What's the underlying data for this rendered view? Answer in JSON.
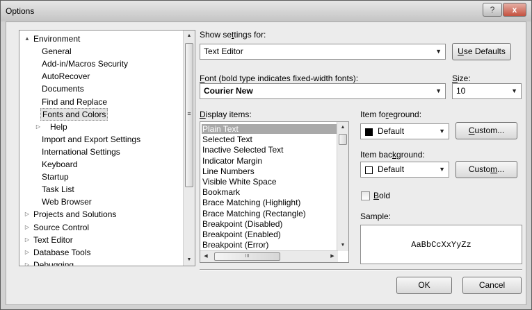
{
  "window": {
    "title": "Options",
    "help_label": "?",
    "close_label": "x"
  },
  "tree": {
    "items": [
      {
        "label": "Environment",
        "arrow": "▲"
      },
      {
        "label": "General"
      },
      {
        "label": "Add-in/Macros Security"
      },
      {
        "label": "AutoRecover"
      },
      {
        "label": "Documents"
      },
      {
        "label": "Find and Replace"
      },
      {
        "label": "Fonts and Colors"
      },
      {
        "label": "Help",
        "arrow": "▷"
      },
      {
        "label": "Import and Export Settings"
      },
      {
        "label": "International Settings"
      },
      {
        "label": "Keyboard"
      },
      {
        "label": "Startup"
      },
      {
        "label": "Task List"
      },
      {
        "label": "Web Browser"
      },
      {
        "label": "Projects and Solutions",
        "arrow": "▷"
      },
      {
        "label": "Source Control",
        "arrow": "▷"
      },
      {
        "label": "Text Editor",
        "arrow": "▷"
      },
      {
        "label": "Database Tools",
        "arrow": "▷"
      },
      {
        "label": "Debugging",
        "arrow": "▷"
      }
    ],
    "selected": "Fonts and Colors"
  },
  "settings": {
    "show_settings_label_pre": "Show se",
    "show_settings_label_u": "t",
    "show_settings_label_post": "tings for:",
    "show_settings_value": "Text Editor",
    "use_defaults_pre": "",
    "use_defaults_u": "U",
    "use_defaults_post": "se Defaults",
    "font_label_u": "F",
    "font_label_post": "ont (bold type indicates fixed-width fonts):",
    "font_value": "Courier New",
    "size_label_u": "S",
    "size_label_post": "ize:",
    "size_value": "10"
  },
  "display_items": {
    "label_u": "D",
    "label_post": "isplay items:",
    "items": [
      "Plain Text",
      "Selected Text",
      "Inactive Selected Text",
      "Indicator Margin",
      "Line Numbers",
      "Visible White Space",
      "Bookmark",
      "Brace Matching (Highlight)",
      "Brace Matching (Rectangle)",
      "Breakpoint (Disabled)",
      "Breakpoint (Enabled)",
      "Breakpoint (Error)"
    ],
    "selected": "Plain Text",
    "hscroll_grip": "III"
  },
  "foreground": {
    "label_pre": "Item fo",
    "label_u": "r",
    "label_post": "eground:",
    "value": "Default",
    "swatch_color": "#000000",
    "custom_u": "C",
    "custom_post": "ustom..."
  },
  "background": {
    "label_pre": "Item bac",
    "label_u": "k",
    "label_post": "ground:",
    "value": "Default",
    "swatch_color": "#ffffff",
    "custom_pre": "Custo",
    "custom_u": "m",
    "custom_post": "..."
  },
  "bold": {
    "label_u": "B",
    "label_post": "old",
    "checked": false
  },
  "sample": {
    "label": "Sample:",
    "text": "AaBbCcXxYyZz"
  },
  "footer": {
    "ok_label": "OK",
    "cancel_label": "Cancel"
  }
}
